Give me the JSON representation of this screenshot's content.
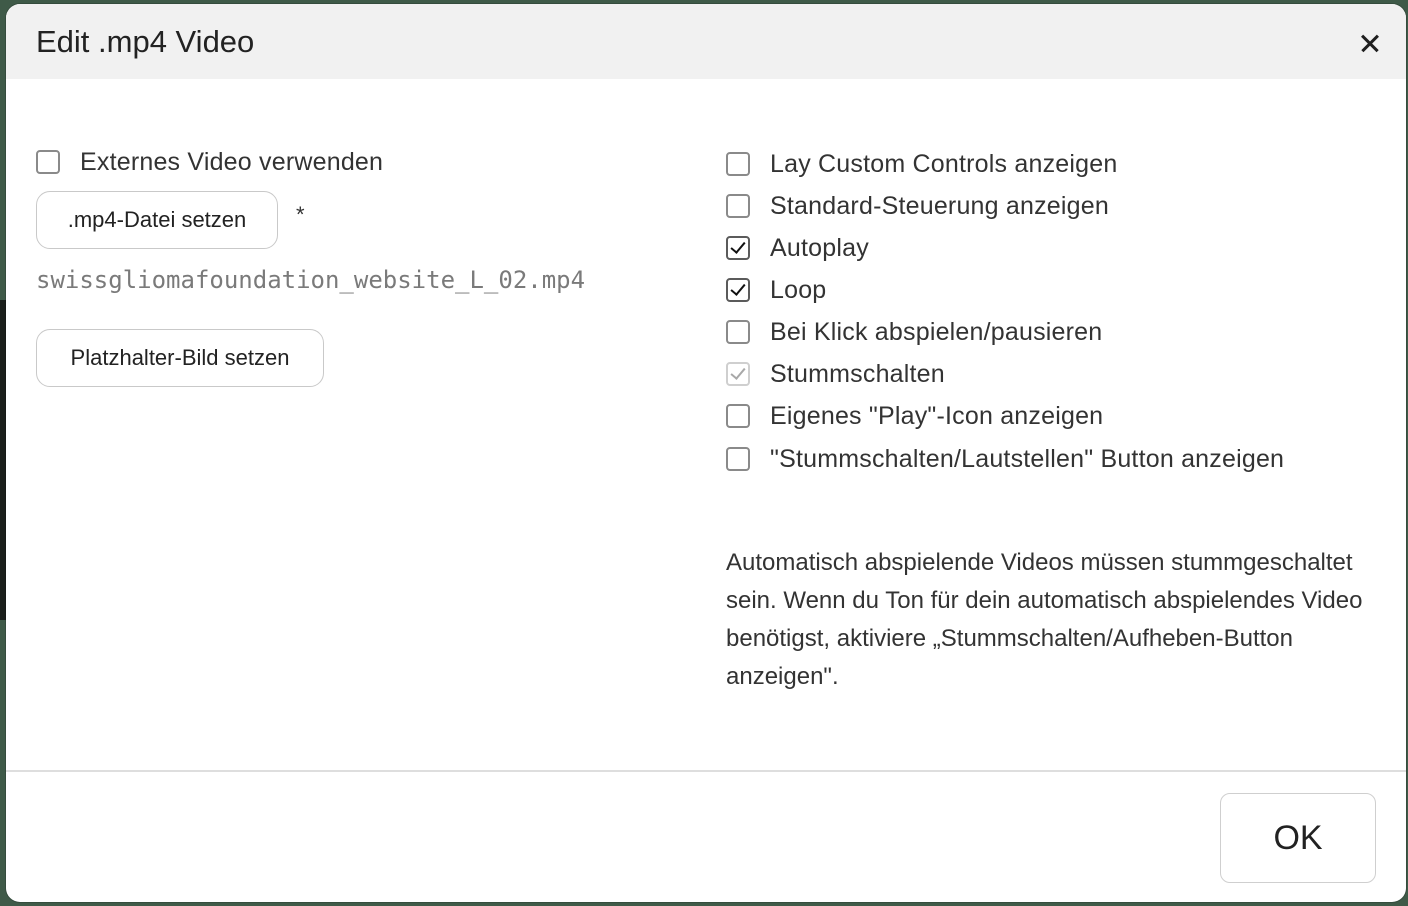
{
  "dialog": {
    "title": "Edit .mp4 Video",
    "close_icon": "close-icon"
  },
  "left": {
    "external_video": {
      "label": "Externes Video verwenden",
      "checked": false
    },
    "set_file_label": ".mp4-Datei setzen",
    "required_marker": "*",
    "filename": "swissgliomafoundation_website_L_02.mp4",
    "set_placeholder_label": "Platzhalter-Bild setzen"
  },
  "options": [
    {
      "label": "Lay Custom Controls anzeigen",
      "checked": false,
      "disabled": false
    },
    {
      "label": "Standard-Steuerung anzeigen",
      "checked": false,
      "disabled": false
    },
    {
      "label": "Autoplay",
      "checked": true,
      "disabled": false
    },
    {
      "label": "Loop",
      "checked": true,
      "disabled": false
    },
    {
      "label": "Bei Klick abspielen/pausieren",
      "checked": false,
      "disabled": false
    },
    {
      "label": "Stummschalten",
      "checked": true,
      "disabled": true
    },
    {
      "label": "Eigenes \"Play\"-Icon anzeigen",
      "checked": false,
      "disabled": false
    },
    {
      "label": "\"Stummschalten/Lautstellen\" Button anzeigen",
      "checked": false,
      "disabled": false
    }
  ],
  "note": "Automatisch abspielende Videos müssen stummgeschaltet sein. Wenn du Ton für dein automatisch abspielendes Video benötigst, aktiviere „Stummschalten/Aufheben-Button anzeigen\".",
  "footer": {
    "ok_label": "OK"
  }
}
